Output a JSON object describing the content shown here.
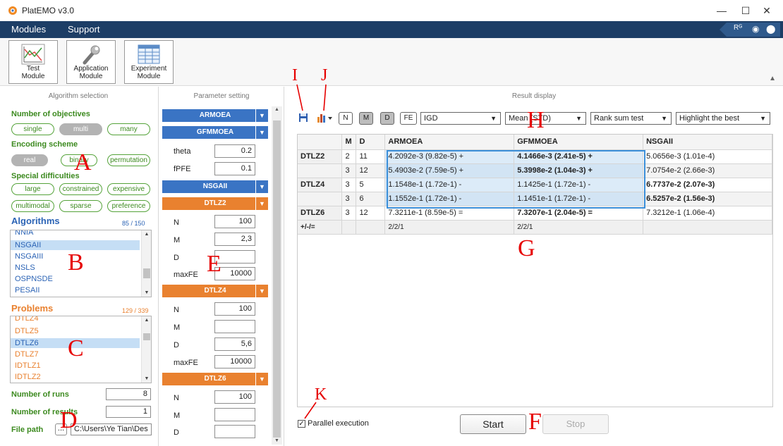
{
  "window": {
    "title": "PlatEMO v3.0",
    "minimize": "—",
    "maximize": "☐",
    "close": "✕"
  },
  "menu": {
    "items": [
      "Modules",
      "Support"
    ],
    "right_icons": [
      "Rᴳ",
      "◉",
      "⬤"
    ]
  },
  "modules": [
    {
      "line1": "Test",
      "line2": "Module"
    },
    {
      "line1": "Application",
      "line2": "Module"
    },
    {
      "line1": "Experiment",
      "line2": "Module"
    }
  ],
  "colors": {
    "menu": "#1d3e66",
    "green": "#3c8a1f",
    "blue": "#3a74c4",
    "orange": "#e9812f",
    "annotation": "#e60000"
  },
  "algorithm_selection": {
    "header": "Algorithm selection",
    "objectives": {
      "label": "Number of objectives",
      "options": [
        "single",
        "multi",
        "many"
      ],
      "selected": "multi"
    },
    "encoding": {
      "label": "Encoding scheme",
      "options": [
        "real",
        "binary",
        "permutation"
      ],
      "selected": "real"
    },
    "special": {
      "label": "Special difficulties",
      "options": [
        "large",
        "constrained",
        "expensive",
        "multimodal",
        "sparse",
        "preference"
      ]
    },
    "algorithms": {
      "title": "Algorithms",
      "count": "85 / 150",
      "items": [
        "NNIA",
        "NSGAII",
        "NSGAIII",
        "NSLS",
        "OSPNSDE",
        "PESAII"
      ],
      "selected": "NSGAII"
    },
    "problems": {
      "title": "Problems",
      "count": "129 / 339",
      "items": [
        "DTLZ4",
        "DTLZ5",
        "DTLZ6",
        "DTLZ7",
        "IDTLZ1",
        "IDTLZ2"
      ],
      "selected": "DTLZ6"
    },
    "runs": {
      "label": "Number of runs",
      "value": "8"
    },
    "results": {
      "label": "Number of results",
      "value": "1"
    },
    "filepath": {
      "label": "File path",
      "browse": "...",
      "value": "C:\\Users\\Ye Tian\\Des"
    }
  },
  "parameter_setting": {
    "header": "Parameter setting",
    "blocks": [
      {
        "name": "ARMOEA",
        "color": "blue",
        "params": []
      },
      {
        "name": "GFMMOEA",
        "color": "blue",
        "params": [
          {
            "label": "theta",
            "value": "0.2"
          },
          {
            "label": "fPFE",
            "value": "0.1"
          }
        ]
      },
      {
        "name": "NSGAII",
        "color": "blue",
        "params": []
      },
      {
        "name": "DTLZ2",
        "color": "orange",
        "params": [
          {
            "label": "N",
            "value": "100"
          },
          {
            "label": "M",
            "value": "2,3"
          },
          {
            "label": "D",
            "value": ""
          },
          {
            "label": "maxFE",
            "value": "10000"
          }
        ]
      },
      {
        "name": "DTLZ4",
        "color": "orange",
        "params": [
          {
            "label": "N",
            "value": "100"
          },
          {
            "label": "M",
            "value": ""
          },
          {
            "label": "D",
            "value": "5,6"
          },
          {
            "label": "maxFE",
            "value": "10000"
          }
        ]
      },
      {
        "name": "DTLZ6",
        "color": "orange",
        "params": [
          {
            "label": "N",
            "value": "100"
          },
          {
            "label": "M",
            "value": ""
          },
          {
            "label": "D",
            "value": ""
          }
        ]
      }
    ]
  },
  "result_display": {
    "header": "Result display",
    "toggles": [
      {
        "label": "N",
        "on": false
      },
      {
        "label": "M",
        "on": true
      },
      {
        "label": "D",
        "on": true
      },
      {
        "label": "FE",
        "on": false
      }
    ],
    "selects": [
      "IGD",
      "Mean (STD)",
      "Rank sum test",
      "Highlight the best"
    ],
    "columns": [
      "",
      "M",
      "D",
      "ARMOEA",
      "GFMMOEA",
      "NSGAII"
    ],
    "rows": [
      {
        "problem": "DTLZ2",
        "m": "2",
        "d": "11",
        "armoea": "4.2092e-3 (9.82e-5) +",
        "gfmmoea": "4.1466e-3 (2.41e-5) +",
        "nsgaii": "5.0656e-3 (1.01e-4)",
        "best": "gfmmoea"
      },
      {
        "problem": "",
        "m": "3",
        "d": "12",
        "armoea": "5.4903e-2 (7.59e-5) +",
        "gfmmoea": "5.3998e-2 (1.04e-3) +",
        "nsgaii": "7.0754e-2 (2.66e-3)",
        "best": "gfmmoea"
      },
      {
        "problem": "DTLZ4",
        "m": "3",
        "d": "5",
        "armoea": "1.1548e-1 (1.72e-1) -",
        "gfmmoea": "1.1425e-1 (1.72e-1) -",
        "nsgaii": "6.7737e-2 (2.07e-3)",
        "best": "nsgaii"
      },
      {
        "problem": "",
        "m": "3",
        "d": "6",
        "armoea": "1.1552e-1 (1.72e-1) -",
        "gfmmoea": "1.1451e-1 (1.72e-1) -",
        "nsgaii": "6.5257e-2 (1.56e-3)",
        "best": "nsgaii"
      },
      {
        "problem": "DTLZ6",
        "m": "3",
        "d": "12",
        "armoea": "7.3211e-1 (8.59e-5) =",
        "gfmmoea": "7.3207e-1 (2.04e-5) =",
        "nsgaii": "7.3212e-1 (1.06e-4)",
        "best": "gfmmoea"
      }
    ],
    "summary": {
      "label": "+/-/=",
      "armoea": "2/2/1",
      "gfmmoea": "2/2/1"
    },
    "parallel": {
      "label": "Parallel execution",
      "checked": true
    },
    "start": "Start",
    "stop": "Stop"
  },
  "annotations": [
    "A",
    "B",
    "C",
    "D",
    "E",
    "F",
    "G",
    "H",
    "I",
    "J",
    "K"
  ]
}
